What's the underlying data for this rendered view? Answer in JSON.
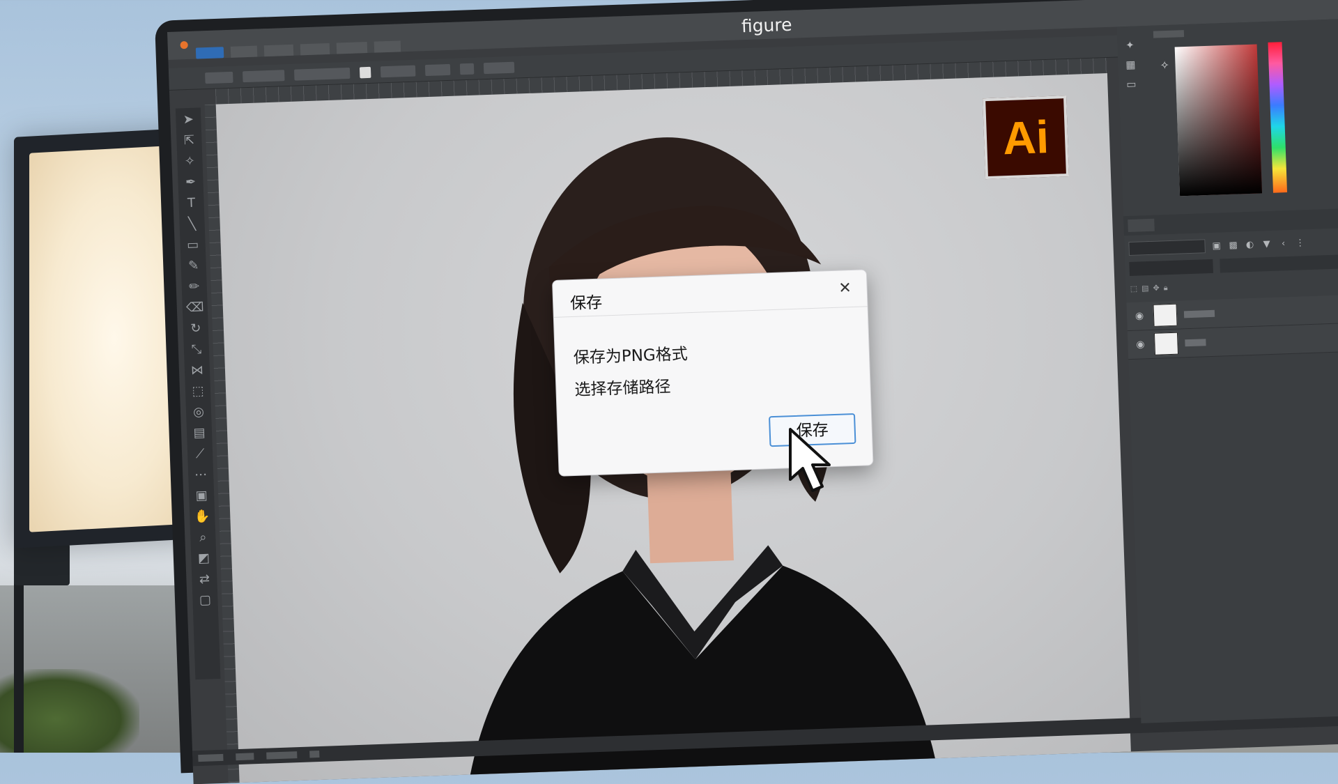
{
  "window": {
    "title": "figure"
  },
  "app": {
    "logo_text": "Ai",
    "logo_bg": "#3a0a00",
    "logo_fg": "#ff9a00"
  },
  "dialog": {
    "title": "保存",
    "close_icon": "close-icon",
    "message_line1": "保存为PNG格式",
    "message_line2": "选择存储路径",
    "save_button": "保存",
    "accent_color": "#4a8fd6"
  },
  "cursor": {
    "icon": "arrow-pointer-icon"
  }
}
